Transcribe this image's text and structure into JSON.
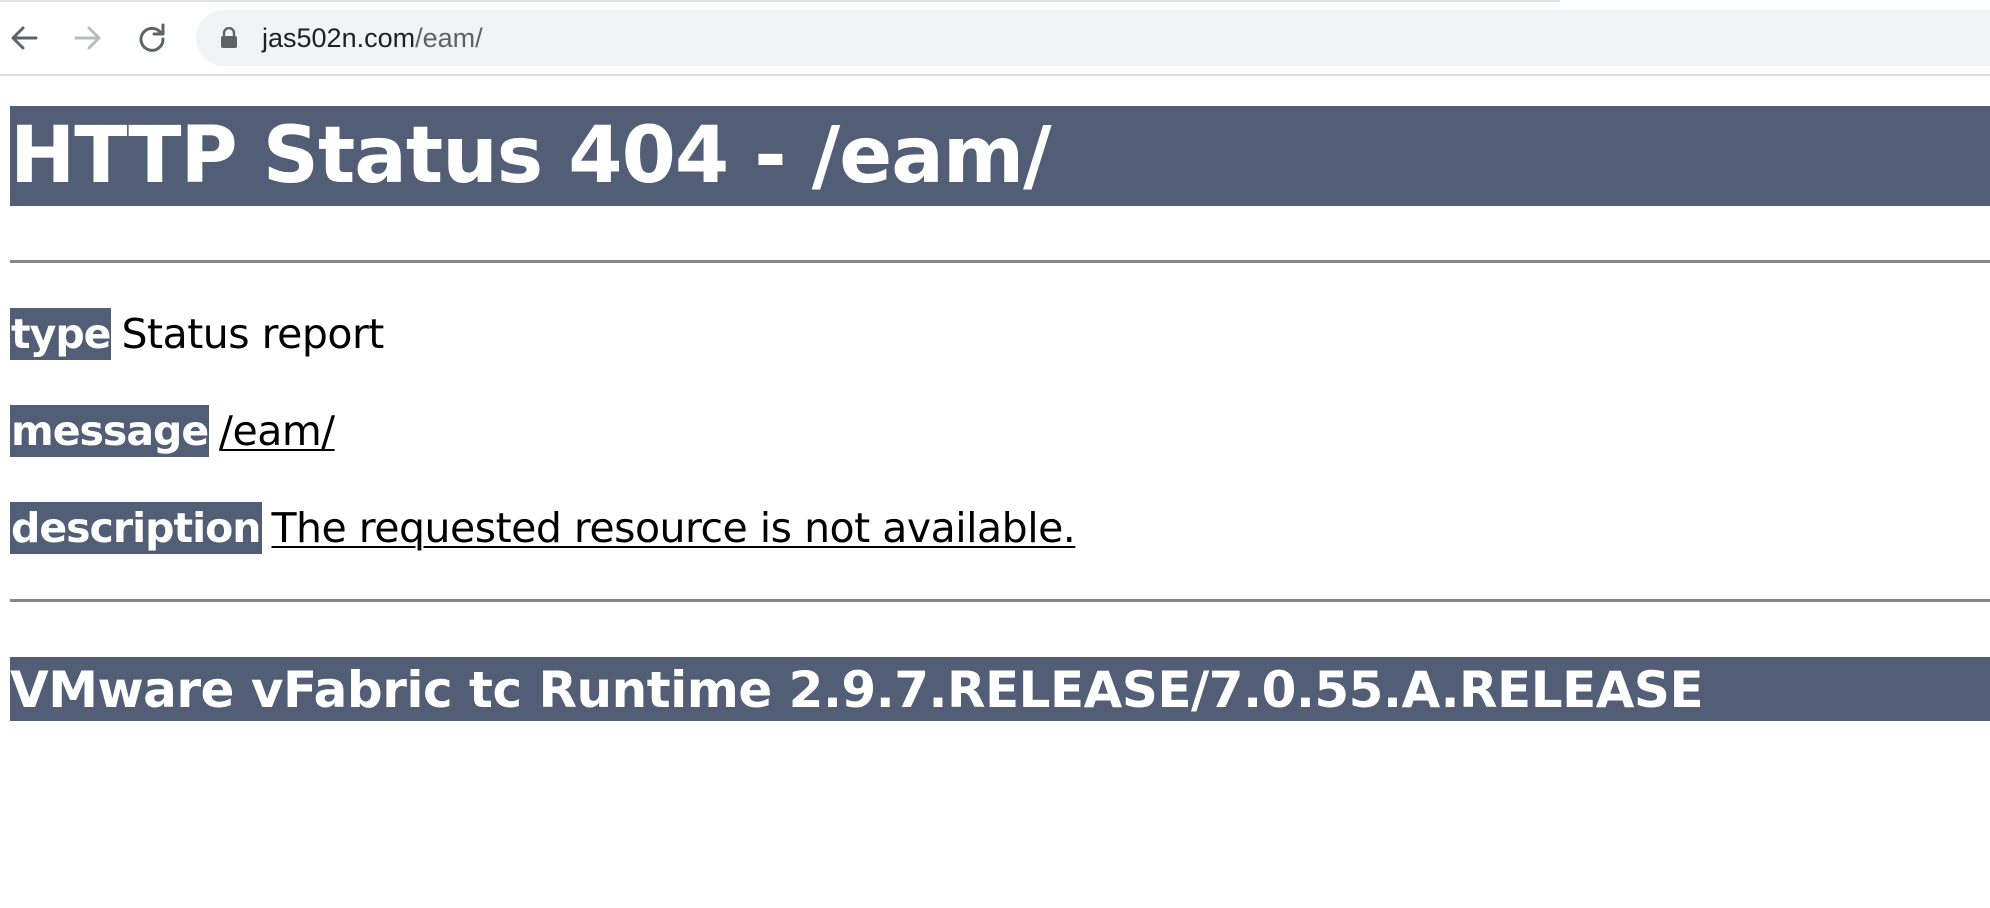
{
  "browser": {
    "url_host": "jas502n.com",
    "url_path": "/eam/",
    "icons": {
      "back": "arrow-left-icon",
      "forward": "arrow-right-icon",
      "reload": "reload-icon",
      "lock": "lock-icon"
    }
  },
  "page": {
    "title": "HTTP Status 404 - /eam/",
    "type_label": "type",
    "type_value": "Status report",
    "message_label": "message",
    "message_value": "/eam/",
    "description_label": "description",
    "description_value": "The requested resource is not available.",
    "footer": "VMware vFabric tc Runtime 2.9.7.RELEASE/7.0.55.A.RELEASE"
  },
  "colors": {
    "heading_bg": "#525d76",
    "heading_text": "#ffffff",
    "rule": "#868686",
    "omnibox_bg": "#f1f3f4"
  }
}
